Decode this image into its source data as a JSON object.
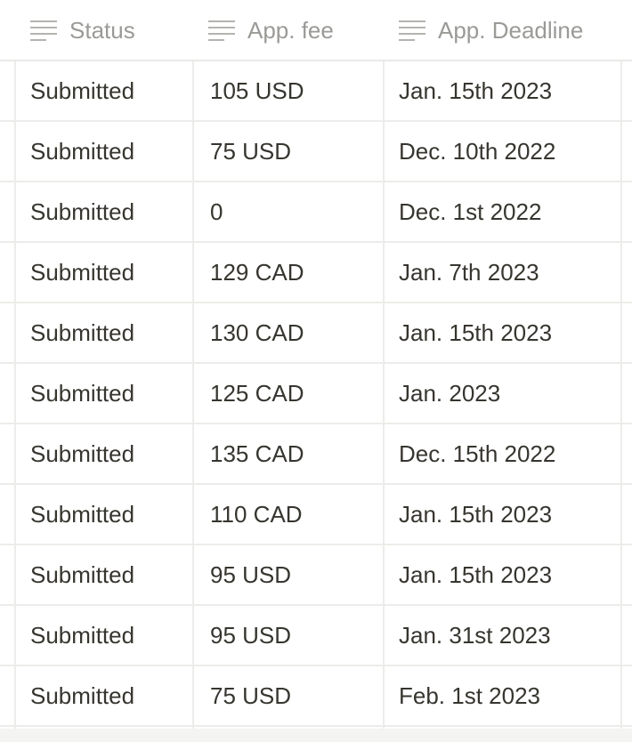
{
  "columns": {
    "status": {
      "label": "Status",
      "icon": "text-lines-icon"
    },
    "fee": {
      "label": "App. fee",
      "icon": "text-lines-icon"
    },
    "deadline": {
      "label": "App. Deadline",
      "icon": "text-lines-icon"
    }
  },
  "rows": [
    {
      "status": "Submitted",
      "fee": "105 USD",
      "deadline": "Jan. 15th 2023"
    },
    {
      "status": "Submitted",
      "fee": "75 USD",
      "deadline": "Dec. 10th 2022"
    },
    {
      "status": "Submitted",
      "fee": "0",
      "deadline": "Dec. 1st 2022"
    },
    {
      "status": "Submitted",
      "fee": "129 CAD",
      "deadline": "Jan. 7th 2023"
    },
    {
      "status": "Submitted",
      "fee": "130 CAD",
      "deadline": "Jan. 15th 2023"
    },
    {
      "status": "Submitted",
      "fee": "125 CAD",
      "deadline": "Jan. 2023"
    },
    {
      "status": "Submitted",
      "fee": "135 CAD",
      "deadline": "Dec. 15th 2022"
    },
    {
      "status": "Submitted",
      "fee": "110 CAD",
      "deadline": "Jan. 15th 2023"
    },
    {
      "status": "Submitted",
      "fee": "95 USD",
      "deadline": "Jan. 15th 2023"
    },
    {
      "status": "Submitted",
      "fee": "95 USD",
      "deadline": "Jan. 31st 2023"
    },
    {
      "status": "Submitted",
      "fee": "75 USD",
      "deadline": "Feb. 1st 2023"
    }
  ],
  "colors": {
    "header_text": "#9b9a97",
    "cell_text": "#37352f",
    "grid_line": "#ececea"
  }
}
